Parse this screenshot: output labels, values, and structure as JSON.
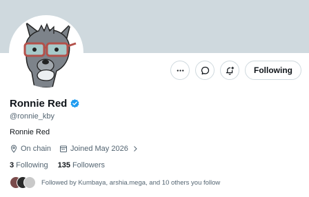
{
  "profile": {
    "name": "Ronnie Red",
    "handle": "@ronnie_kby",
    "bio": "Ronnie Red",
    "location": "On chain",
    "joined": "Joined May 2026",
    "following_count": "3",
    "following_label": "Following",
    "followers_count": "135",
    "followers_label": "Followers",
    "followed_by": "Followed by Kumbaya, arshia.mega, and 10 others you follow"
  },
  "actions": {
    "more_icon": "more-horizontal-icon",
    "message_icon": "message-bubble-icon",
    "notify_icon": "bell-plus-icon",
    "follow_label": "Following"
  },
  "colors": {
    "banner": "#cfd9de",
    "verified": "#1d9bf0",
    "text": "#0f1419",
    "muted": "#536471",
    "border": "#cfd9de"
  }
}
